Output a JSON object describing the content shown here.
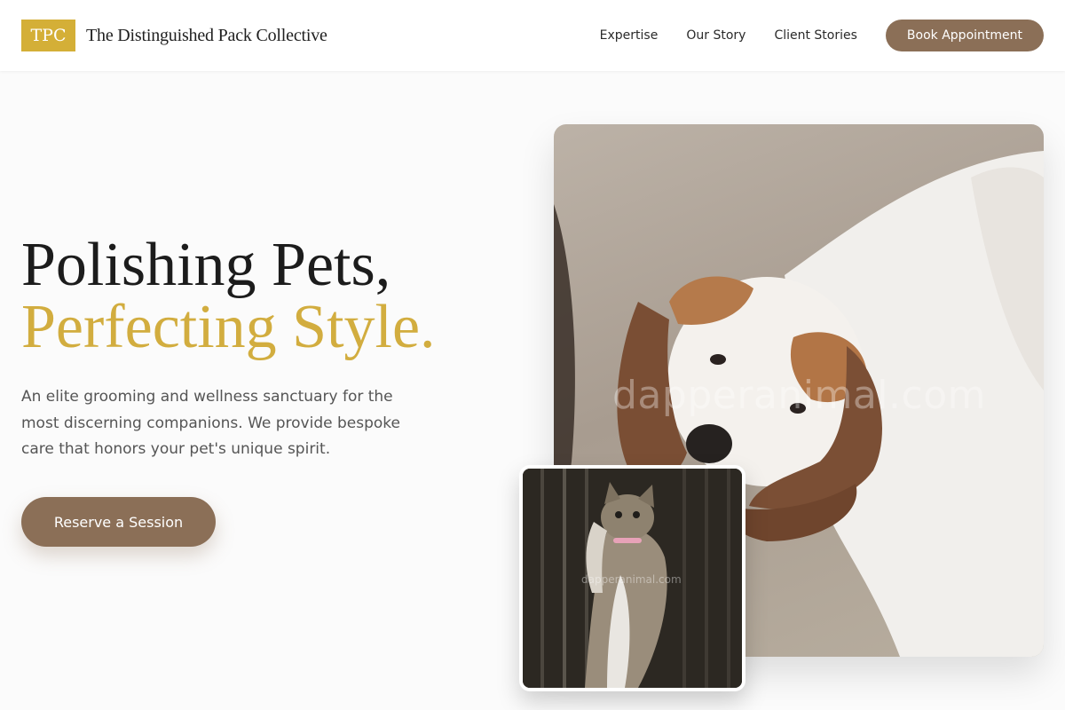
{
  "header": {
    "logo_text": "TPC",
    "brand_name": "The Distinguished Pack Collective",
    "nav": [
      "Expertise",
      "Our Story",
      "Client Stories"
    ],
    "cta_label": "Book Appointment"
  },
  "hero": {
    "title_line1": "Polishing Pets,",
    "title_line2": "Perfecting Style.",
    "description": "An elite grooming and wellness sanctuary for the most discerning companions. We provide bespoke care that honors your pet's unique spirit.",
    "cta_label": "Reserve a Session"
  },
  "images": {
    "main_watermark": "dapperanimal.com",
    "secondary_watermark": "dapperanimal.com"
  },
  "colors": {
    "gold": "#d4af37",
    "brown": "#8b6f57"
  }
}
